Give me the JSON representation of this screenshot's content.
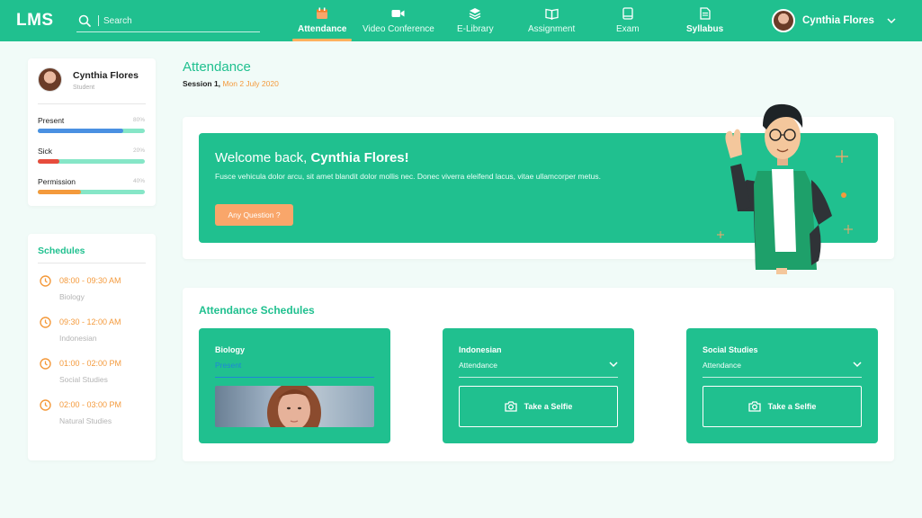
{
  "app": {
    "logo": "LMS"
  },
  "search": {
    "placeholder": "Search"
  },
  "nav": [
    {
      "label": "Attendance",
      "icon": "calendar-icon"
    },
    {
      "label": "Video Conference",
      "icon": "video-camera-icon"
    },
    {
      "label": "E-Library",
      "icon": "layers-icon"
    },
    {
      "label": "Assignment",
      "icon": "open-book-icon"
    },
    {
      "label": "Exam",
      "icon": "book-icon"
    },
    {
      "label": "Syllabus",
      "icon": "document-icon"
    }
  ],
  "user": {
    "name": "Cynthia Flores",
    "role": "Student"
  },
  "stats": [
    {
      "label": "Present",
      "percent_text": "80%",
      "value": 0.8,
      "color": "#4a90e2"
    },
    {
      "label": "Sick",
      "percent_text": "20%",
      "value": 0.2,
      "color": "#e74c3c"
    },
    {
      "label": "Permission",
      "percent_text": "40%",
      "value": 0.4,
      "color": "#f49a3c"
    }
  ],
  "schedules": {
    "title": "Schedules",
    "items": [
      {
        "time": "08:00 - 09:30 AM",
        "subject": "Biology"
      },
      {
        "time": "09:30 - 12:00 AM",
        "subject": "Indonesian"
      },
      {
        "time": "01:00 - 02:00 PM",
        "subject": "Social Studies"
      },
      {
        "time": "02:00 - 03:00 PM",
        "subject": "Natural Studies"
      }
    ]
  },
  "page": {
    "title": "Attendance",
    "session_label": "Session 1,",
    "session_date": "Mon 2 July 2020"
  },
  "welcome": {
    "greeting": "Welcome back,",
    "name": "Cynthia Flores!",
    "description": "Fusce vehicula dolor arcu, sit amet blandit dolor mollis nec. Donec viverra eleifend lacus, vitae ullamcorper metus.",
    "button": "Any Question ?"
  },
  "attendance": {
    "title": "Attendance Schedules",
    "cards": [
      {
        "subject": "Biology",
        "status": "Present"
      },
      {
        "subject": "Indonesian",
        "status": "Attendance",
        "action": "Take a Selfie"
      },
      {
        "subject": "Social Studies",
        "status": "Attendance",
        "action": "Take a Selfie"
      }
    ]
  },
  "colors": {
    "primary": "#20c08f",
    "accent": "#f49a3c",
    "button": "#f9a66a"
  }
}
